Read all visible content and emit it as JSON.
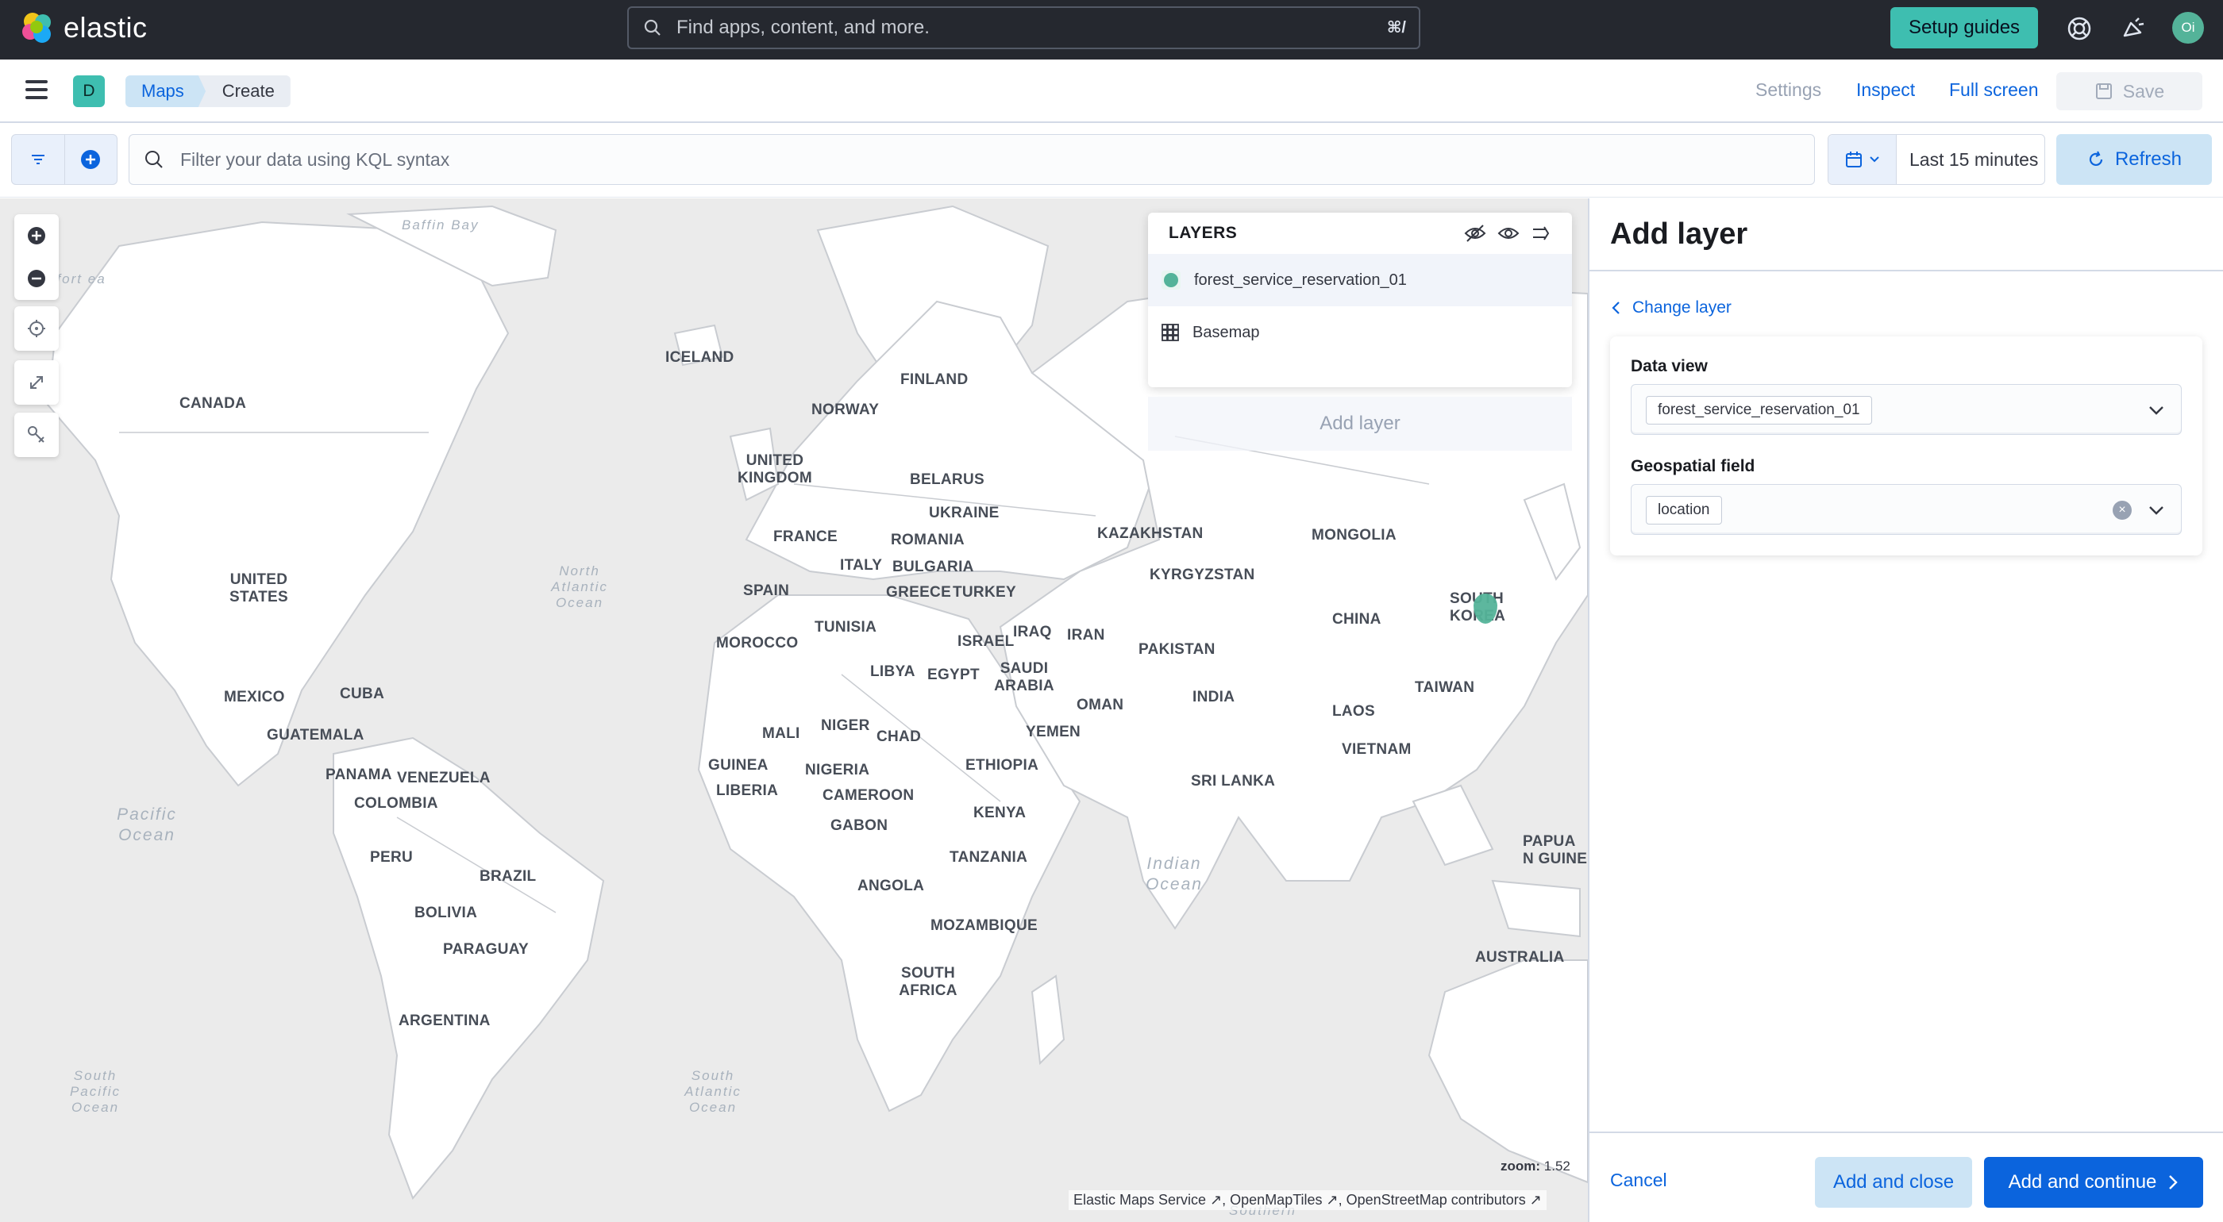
{
  "brand": {
    "name": "elastic"
  },
  "header": {
    "search_placeholder": "Find apps, content, and more.",
    "search_shortcut": "⌘/",
    "setup_guides": "Setup guides",
    "user_initials": "Oi"
  },
  "app": {
    "space_initial": "D",
    "breadcrumbs": [
      "Maps",
      "Create"
    ],
    "links": {
      "settings": "Settings",
      "inspect": "Inspect",
      "full_screen": "Full screen",
      "save": "Save"
    }
  },
  "query": {
    "kql_placeholder": "Filter your data using KQL syntax",
    "time_range": "Last 15 minutes",
    "refresh": "Refresh"
  },
  "map": {
    "zoom_label": "zoom:",
    "zoom": "1.52",
    "attribution": [
      "Elastic Maps Service",
      "OpenMapTiles",
      "OpenStreetMap contributors"
    ],
    "countries": {
      "canada": "CANADA",
      "usa": "UNITED STATES",
      "mexico": "MEXICO",
      "cuba": "CUBA",
      "guatemala": "GUATEMALA",
      "panama": "PANAMA",
      "venezuela": "VENEZUELA",
      "colombia": "COLOMBIA",
      "peru": "PERU",
      "brazil": "BRAZIL",
      "bolivia": "BOLIVIA",
      "paraguay": "PARAGUAY",
      "argentina": "ARGENTINA",
      "iceland": "ICELAND",
      "finland": "FINLAND",
      "norway": "NORWAY",
      "uk": "UNITED KINGDOM",
      "belarus": "BELARUS",
      "ukraine": "UKRAINE",
      "france": "FRANCE",
      "romania": "ROMANIA",
      "italy": "ITALY",
      "bulgaria": "BULGARIA",
      "spain": "SPAIN",
      "greece": "GREECE",
      "turkey": "TURKEY",
      "tunisia": "TUNISIA",
      "morocco": "MOROCCO",
      "iraq": "IRAQ",
      "israel": "ISRAEL",
      "iran": "IRAN",
      "libya": "LIBYA",
      "egypt": "EGYPT",
      "saudi": "SAUDI ARABIA",
      "oman": "OMAN",
      "yemen": "YEMEN",
      "mali": "MALI",
      "niger": "NIGER",
      "chad": "CHAD",
      "guinea": "GUINEA",
      "nigeria": "NIGERIA",
      "ethiopia": "ETHIOPIA",
      "liberia": "LIBERIA",
      "cameroon": "CAMEROON",
      "gabon": "GABON",
      "kenya": "KENYA",
      "tanzania": "TANZANIA",
      "angola": "ANGOLA",
      "mozambique": "MOZAMBIQUE",
      "south_africa": "SOUTH AFRICA",
      "kazakhstan": "KAZAKHSTAN",
      "mongolia": "MONGOLIA",
      "kyrgyzstan": "KYRGYZSTAN",
      "china": "CHINA",
      "pakistan": "PAKISTAN",
      "india": "INDIA",
      "south_korea": "SOUTH KOREA",
      "taiwan": "TAIWAN",
      "laos": "LAOS",
      "vietnam": "VIETNAM",
      "sri_lanka": "SRI LANKA",
      "papua": "PAPUA N GUINE",
      "australia": "AUSTRALIA"
    },
    "oceans": {
      "baffin": "Baffin Bay",
      "north_atlantic": "North Atlantic Ocean",
      "pacific": "Pacific Ocean",
      "indian": "Indian Ocean",
      "south_pacific": "South Pacific Ocean",
      "south_atlantic": "South Atlantic Ocean",
      "beaufort": "ufort ea",
      "southern": "Southern"
    }
  },
  "layers": {
    "title": "LAYERS",
    "items": [
      {
        "name": "forest_service_reservation_01",
        "color": "#54b399"
      },
      {
        "name": "Basemap"
      }
    ],
    "add_layer": "Add layer"
  },
  "flyout": {
    "title": "Add layer",
    "change_layer": "Change layer",
    "data_view_label": "Data view",
    "data_view_value": "forest_service_reservation_01",
    "geo_field_label": "Geospatial field",
    "geo_field_value": "location",
    "cancel": "Cancel",
    "add_and_close": "Add and close",
    "add_and_continue": "Add and continue"
  },
  "colors": {
    "accent": "#0b64dd",
    "teal": "#3ebeb0",
    "layer": "#54b399",
    "header_bg": "#25282f"
  }
}
